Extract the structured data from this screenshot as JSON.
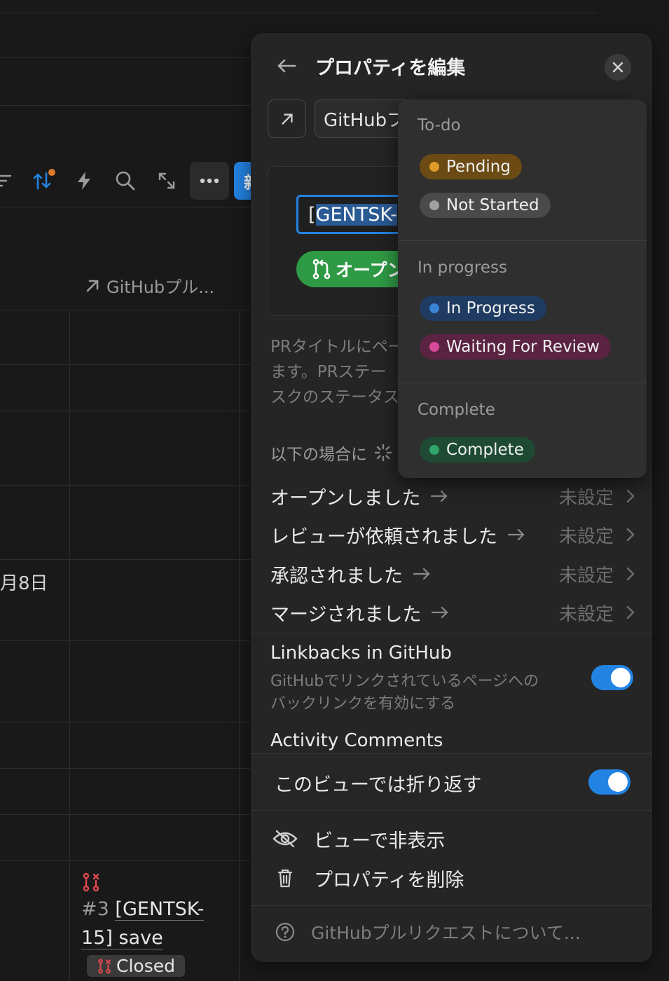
{
  "background": {
    "column_header": "GitHubプル...",
    "date_cell": "月8日",
    "new_button_label": "新",
    "pr_item": {
      "number": "#3",
      "title_part1": "[GENTSK-",
      "title_part2": "15] save",
      "status": "Closed"
    }
  },
  "panel": {
    "title": "プロパティを編集",
    "property_name": "GitHubプルリクエスト",
    "preview": {
      "input_prefix": "[",
      "input_selected": "GENTSK-",
      "badge_label": "オープン"
    },
    "description": "PRタイトルにページIDを含めると、PRがリンクされます。PRステータスに基づいてタスクのステータスを自動更新できます。",
    "description_lines": [
      "PRタイトルにペー",
      "ます。PRステー",
      "スクのステータス"
    ],
    "condition_label": "以下の場合に",
    "rules": [
      {
        "label": "オープンしました",
        "value": "未設定"
      },
      {
        "label": "レビューが依頼されました",
        "value": "未設定"
      },
      {
        "label": "承認されました",
        "value": "未設定"
      },
      {
        "label": "マージされました",
        "value": "未設定"
      }
    ],
    "linkbacks": {
      "title": "Linkbacks in GitHub",
      "desc_line1": "GitHubでリンクされているページへの",
      "desc_line2": "バックリンクを有効にする",
      "enabled": true
    },
    "activity_comments": {
      "title": "Activity Comments"
    },
    "wrap": {
      "label": "このビューでは折り返す",
      "enabled": true
    },
    "actions": {
      "hide": "ビューで非表示",
      "delete": "プロパティを削除"
    },
    "help": "GitHubプルリクエストについて..."
  },
  "dropdown": {
    "groups": [
      {
        "label": "To-do",
        "options": [
          {
            "label": "Pending",
            "dot": "#e09a2a",
            "bg": "#6b4a14"
          },
          {
            "label": "Not Started",
            "dot": "#a0a0a0",
            "bg": "#4a4a4a"
          }
        ]
      },
      {
        "label": "In progress",
        "options": [
          {
            "label": "In Progress",
            "dot": "#3b82d6",
            "bg": "#1f3b61"
          },
          {
            "label": "Waiting For Review",
            "dot": "#d9479a",
            "bg": "#5a2342"
          }
        ]
      },
      {
        "label": "Complete",
        "options": [
          {
            "label": "Complete",
            "dot": "#2fa46b",
            "bg": "#1e4a34"
          }
        ]
      }
    ]
  },
  "colors": {
    "accent": "#2383e2",
    "open_badge": "#2f9a45",
    "closed_icon": "#e0484f",
    "sort_indicator": "#e0782a"
  }
}
